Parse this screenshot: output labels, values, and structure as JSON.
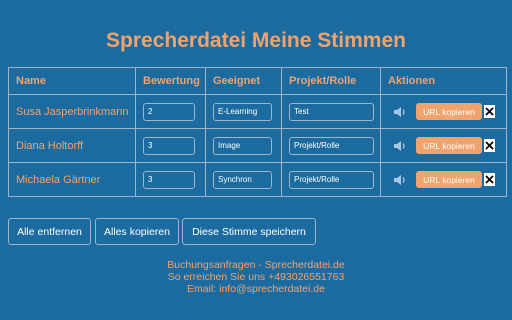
{
  "title": "Sprecherdatei Meine Stimmen",
  "colors": {
    "background": "#1c6ba0",
    "accent": "#f0a36c",
    "border": "#a0b5c8",
    "text_light": "#ffffff"
  },
  "table": {
    "headers": [
      "Name",
      "Bewertung",
      "Geeignet",
      "Projekt/Rolle",
      "Aktionen"
    ],
    "rows": [
      {
        "name": "Susa Jasperbrinkmann",
        "rating": "2",
        "suitable": "E-Learning",
        "project": "Test"
      },
      {
        "name": "Diana Holtorff",
        "rating": "3",
        "suitable": "Image",
        "project": "Projekt/Rolle"
      },
      {
        "name": "Michaela Gärtner",
        "rating": "3",
        "suitable": "Synchron",
        "project": "Projekt/Rolle"
      }
    ],
    "copy_url_label": "URL kopieren",
    "play_icon": "speaker-icon",
    "remove_icon": "close-icon"
  },
  "buttons": {
    "remove_all": "Alle entfernen",
    "copy_all": "Alles kopieren",
    "save_voice": "Diese Stimme speichern"
  },
  "footer": {
    "line1": "Buchungsanfragen - Sprecherdatei.de",
    "line2": "So erreichen Sie uns +493026551763",
    "line3": "Email: info@sprecherdatei.de"
  }
}
